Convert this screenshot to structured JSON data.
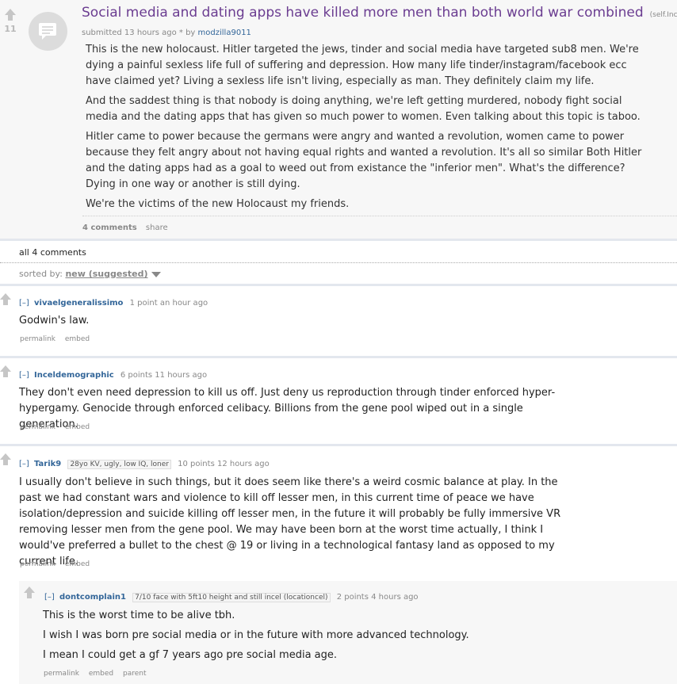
{
  "post": {
    "score": "11",
    "title": "Social media and dating apps have killed more men than both world war combined",
    "domain": "(self.Incels)",
    "tagline_prefix": "submitted 13 hours ago * by",
    "author": "modzilla9011",
    "paragraphs": [
      "This is the new holocaust. Hitler targeted the jews, tinder and social media have targeted sub8 men. We're dying a painful sexless life full of suffering and depression. How many life tinder/instagram/facebook ecc have claimed yet? Living a sexless life isn't living, especially as man. They definitely claim my life.",
      "And the saddest thing is that nobody is doing anything, we're left getting murdered, nobody fight social media and the dating apps that has given so much power to women. Even talking about this topic is taboo.",
      "Hitler came to power because the germans were angry and wanted a revolution, women came to power because they felt angry about not having equal rights and wanted a revolution. It's all so similar Both Hitler and the dating apps had as a goal to weed out from existance the \"inferior men\". What's the difference? Dying in one way or another is still dying.",
      "We're the victims of the new Holocaust my friends."
    ],
    "comments_link": "4 comments",
    "share_link": "share"
  },
  "comments_header": {
    "all": "all 4 comments",
    "sorted_label": "sorted by:",
    "sort_value": "new (suggested)"
  },
  "comments": [
    {
      "toggle": "[–]",
      "author": "vivaelgeneralissimo",
      "flair": "",
      "meta": "1 point an hour ago",
      "paragraphs": [
        "Godwin's law."
      ],
      "buttons": [
        "permalink",
        "embed"
      ]
    },
    {
      "toggle": "[–]",
      "author": "Inceldemographic",
      "flair": "",
      "meta": "6 points 11 hours ago",
      "paragraphs": [
        "They don't even need depression to kill us off. Just deny us reproduction through tinder enforced hyper-hypergamy. Genocide through enforced celibacy. Billions from the gene pool wiped out in a single generation."
      ],
      "buttons": [
        "permalink",
        "embed"
      ]
    },
    {
      "toggle": "[–]",
      "author": "Tarik9",
      "flair": "28yo KV, ugly, low IQ, loner",
      "meta": "10 points 12 hours ago",
      "paragraphs": [
        "I usually don't believe in such things, but it does seem like there's a weird cosmic balance at play. In the past we had constant wars and violence to kill off lesser men, in this current time of peace we have isolation/depression and suicide killing off lesser men, in the future it will probably be fully immersive VR removing lesser men from the gene pool. We may have been born at the worst time actually, I think I would've preferred a bullet to the chest @ 19 or living in a technological fantasy land as opposed to my current life."
      ],
      "buttons": [
        "permalink",
        "embed"
      ]
    },
    {
      "toggle": "[–]",
      "author": "dontcomplain1",
      "flair": "7/10 face with 5ft10 height and still incel (locationcel)",
      "meta": "2 points 4 hours ago",
      "paragraphs": [
        "This is the worst time to be alive tbh.",
        "I wish I was born pre social media or in the future with more advanced technology.",
        "I mean I could get a gf 7 years ago pre social media age."
      ],
      "buttons": [
        "permalink",
        "embed",
        "parent"
      ]
    }
  ]
}
